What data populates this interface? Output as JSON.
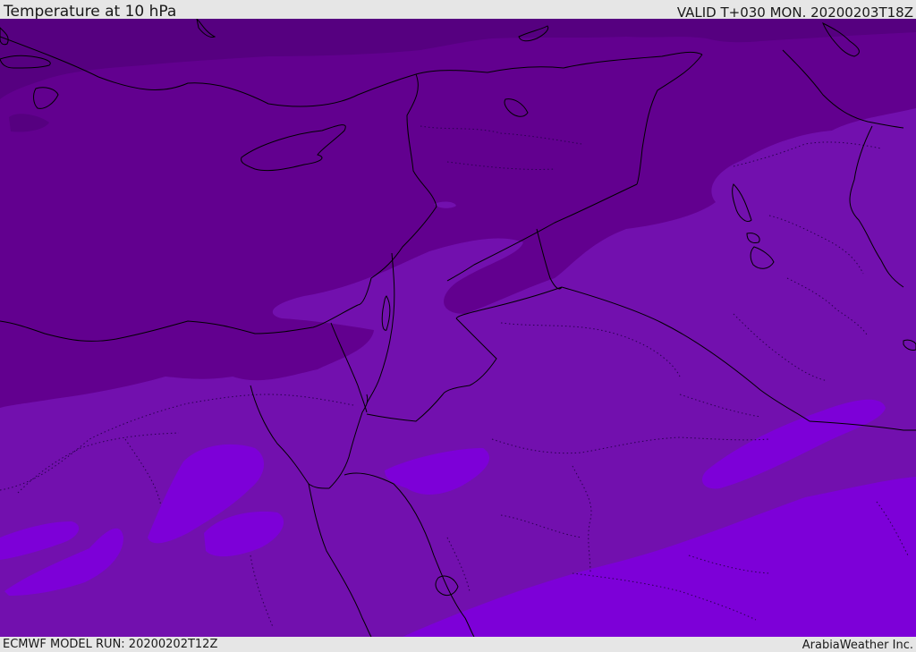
{
  "header": {
    "title": "Temperature at 10 hPa",
    "valid": "VALID T+030 MON. 20200203T18Z"
  },
  "footer": {
    "model_run": "ECMWF MODEL RUN: 20200202T12Z",
    "credit": "ArabiaWeather Inc."
  },
  "map": {
    "variable": "temperature",
    "level": "10 hPa",
    "colors": {
      "band_darkest": "#560080",
      "band_dark": "#62008f",
      "band_mid": "#7210ae",
      "band_light": "#7d00d8",
      "band_lightest": "#8400ee",
      "borders": "#000000",
      "coastline": "#000000"
    }
  }
}
